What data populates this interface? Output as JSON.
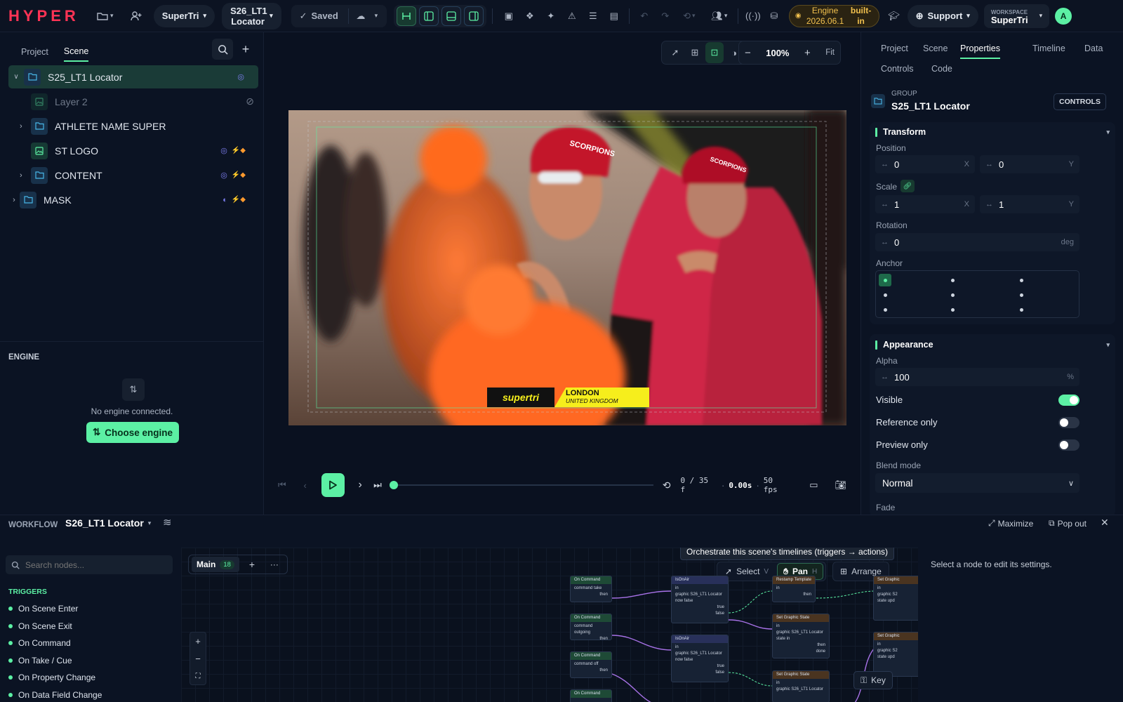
{
  "app": {
    "logo": "HYPER"
  },
  "topbar": {
    "project": "SuperTri",
    "scene_name": "S26_LT1 Locator",
    "saved": "Saved",
    "engine_line1": "Engine",
    "engine_line2": "2026.06.1",
    "builtin": "built-in",
    "support": "Support",
    "workspace_label": "WORKSPACE",
    "workspace_name": "SuperTri",
    "avatar": "A",
    "accent": "#5cf0a4",
    "engine_color": "#f2c14e"
  },
  "left": {
    "tabs": [
      "Project",
      "Scene"
    ],
    "active_tab": "Scene",
    "tree": [
      {
        "label": "S25_LT1 Locator",
        "type": "folder",
        "selected": true
      },
      {
        "label": "Layer 2",
        "type": "image",
        "hidden": true
      },
      {
        "label": "ATHLETE NAME SUPER",
        "type": "folder"
      },
      {
        "label": "ST LOGO",
        "type": "image"
      },
      {
        "label": "CONTENT",
        "type": "folder"
      },
      {
        "label": "MASK",
        "type": "folder"
      }
    ],
    "engine": {
      "title": "ENGINE",
      "message": "No engine connected.",
      "button": "Choose engine"
    }
  },
  "viewport": {
    "zoom": "100%",
    "fit": "Fit",
    "overlay": {
      "brand": "supertri",
      "city": "LONDON",
      "country": "UNITED KINGDOM"
    },
    "swimmer_caps": [
      "SCORPIONS",
      "SCORPIONS"
    ],
    "timecode": "0 / 35 f",
    "seconds": "0.00s",
    "fps": "50 fps"
  },
  "right": {
    "tabs": [
      "Project",
      "Scene",
      "Properties",
      "Timeline",
      "Data",
      "Controls",
      "Code"
    ],
    "active_tab": "Properties",
    "group_label": "GROUP",
    "group_name": "S25_LT1 Locator",
    "controls_btn": "CONTROLS",
    "transform": {
      "title": "Transform",
      "position_label": "Position",
      "pos_x": "0",
      "pos_y": "0",
      "scale_label": "Scale",
      "scale_x": "1",
      "scale_y": "1",
      "rotation_label": "Rotation",
      "rotation": "0",
      "rotation_unit": "deg",
      "anchor_label": "Anchor",
      "x_unit": "X",
      "y_unit": "Y"
    },
    "appearance": {
      "title": "Appearance",
      "alpha_label": "Alpha",
      "alpha": "100",
      "alpha_unit": "%",
      "visible": "Visible",
      "visible_on": true,
      "reference": "Reference only",
      "reference_on": false,
      "preview": "Preview only",
      "preview_on": false,
      "blend_label": "Blend mode",
      "blend": "Normal",
      "fade_label": "Fade"
    }
  },
  "workflow": {
    "label": "WORKFLOW",
    "name": "S26_LT1 Locator",
    "maximize": "Maximize",
    "popout": "Pop out",
    "search_placeholder": "Search nodes...",
    "triggers_title": "TRIGGERS",
    "triggers": [
      "On Scene Enter",
      "On Scene Exit",
      "On Command",
      "On Take / Cue",
      "On Property Change",
      "On Data Field Change"
    ],
    "tab_main": "Main",
    "tab_count": "18",
    "tooltip": "Orchestrate this scene's timelines (triggers → actions)",
    "tools": {
      "select": "Select",
      "select_key": "V",
      "pan": "Pan",
      "pan_key": "H",
      "arrange": "Arrange"
    },
    "key_btn": "Key",
    "inspector_hint": "Select a node to edit its settings.",
    "nodes": [
      {
        "title": "On Command",
        "lines": [
          "command take",
          "then"
        ]
      },
      {
        "title": "On Command",
        "lines": [
          "command outgoing",
          "then"
        ]
      },
      {
        "title": "On Command",
        "lines": [
          "command off",
          "then"
        ]
      },
      {
        "title": "On Command",
        "lines": []
      },
      {
        "title": "IsOnAir",
        "lines": [
          "in",
          "graphic S26_LT1 Locator",
          "now false",
          "true",
          "false"
        ]
      },
      {
        "title": "IsOnAir",
        "lines": [
          "in",
          "graphic S26_LT1 Locator",
          "now false",
          "true",
          "false"
        ]
      },
      {
        "title": "Restamp Template",
        "lines": [
          "in",
          "then"
        ]
      },
      {
        "title": "Set Graphic State",
        "lines": [
          "in",
          "graphic S26_LT1 Locator",
          "state in",
          "then",
          "done"
        ]
      },
      {
        "title": "Set Graphic State",
        "lines": [
          "in",
          "graphic S26_LT1 Locator"
        ]
      },
      {
        "title": "Set Graphic",
        "lines": [
          "in",
          "graphic S2",
          "state upd"
        ]
      },
      {
        "title": "Set Graphic",
        "lines": [
          "in",
          "graphic S2",
          "state upd"
        ]
      }
    ]
  }
}
